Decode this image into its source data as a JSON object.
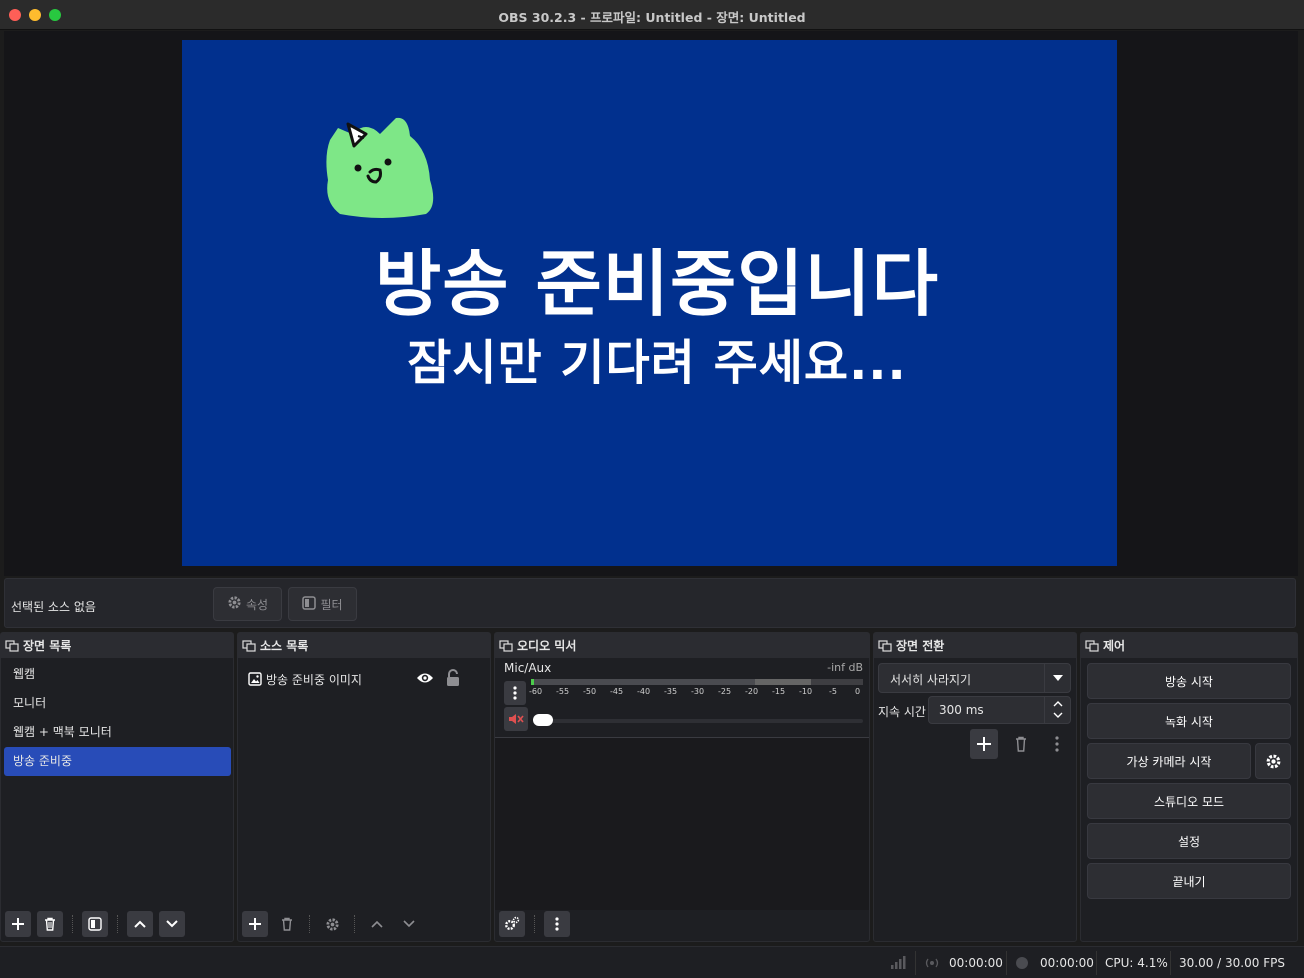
{
  "window": {
    "title": "OBS 30.2.3 - 프로파일: Untitled - 장면: Untitled"
  },
  "preview": {
    "headline": "방송 준비중입니다",
    "subline": "잠시만 기다려 주세요...",
    "background": "#01308e",
    "mascot_color": "#7ee787"
  },
  "context_bar": {
    "no_source": "선택된 소스 없음",
    "properties": "속성",
    "filters": "필터"
  },
  "scenes": {
    "title": "장면 목록",
    "items": [
      {
        "label": "웹캠"
      },
      {
        "label": "모니터"
      },
      {
        "label": "웹캠 + 맥북 모니터"
      },
      {
        "label": "방송 준비중"
      }
    ],
    "active_index": 3
  },
  "sources": {
    "title": "소스 목록",
    "items": [
      {
        "label": "방송 준비중 이미지"
      }
    ]
  },
  "audio": {
    "title": "오디오 믹서",
    "channel": {
      "name": "Mic/Aux",
      "level": "-inf dB"
    },
    "ticks": [
      "-60",
      "-55",
      "-50",
      "-45",
      "-40",
      "-35",
      "-30",
      "-25",
      "-20",
      "-15",
      "-10",
      "-5",
      "0"
    ]
  },
  "transitions": {
    "title": "장면 전환",
    "selected": "서서히 사라지기",
    "duration_label": "지속 시간",
    "duration_value": "300 ms"
  },
  "controls": {
    "title": "제어",
    "start_streaming": "방송 시작",
    "start_recording": "녹화 시작",
    "start_virtual_cam": "가상 카메라 시작",
    "studio_mode": "스튜디오 모드",
    "settings": "설정",
    "exit": "끝내기"
  },
  "status": {
    "stream_time": "00:00:00",
    "rec_time": "00:00:00",
    "cpu": "CPU: 4.1%",
    "fps": "30.00 / 30.00 FPS"
  },
  "colors": {
    "accent": "#284cb8",
    "panel": "#1e1f23",
    "header": "#2b2c31"
  }
}
